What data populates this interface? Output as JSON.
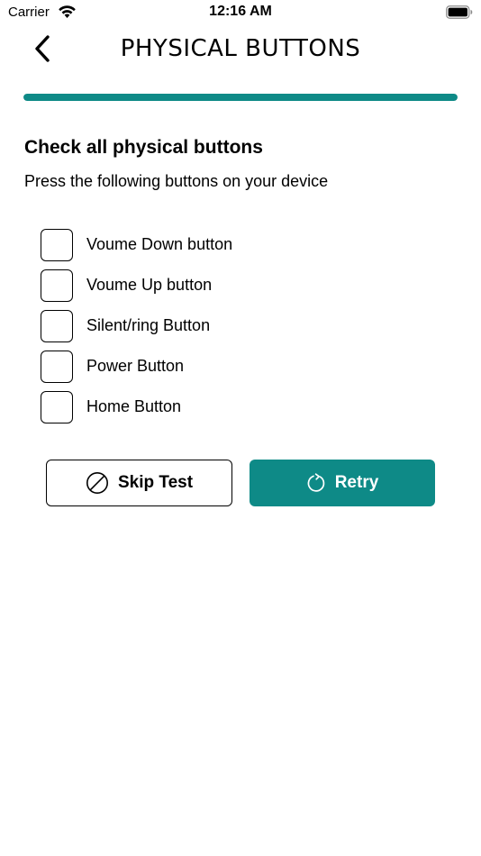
{
  "status_bar": {
    "carrier": "Carrier",
    "time": "12:16 AM",
    "wifi_icon": "wifi-icon",
    "battery_icon": "battery-icon"
  },
  "nav": {
    "back_icon": "chevron-left-icon",
    "title": "PHYSICAL BUTTONS"
  },
  "progress": {
    "value": 1.0,
    "color": "#0e8a87"
  },
  "content": {
    "title": "Check all physical buttons",
    "subtitle": "Press the following buttons on your device",
    "items": [
      {
        "label": "Voume Down button",
        "checked": false
      },
      {
        "label": "Voume Up button",
        "checked": false
      },
      {
        "label": "Silent/ring Button",
        "checked": false
      },
      {
        "label": "Power Button",
        "checked": false
      },
      {
        "label": "Home Button",
        "checked": false
      }
    ]
  },
  "actions": {
    "skip_label": "Skip Test",
    "skip_icon": "prohibited-icon",
    "retry_label": "Retry",
    "retry_icon": "refresh-icon"
  },
  "colors": {
    "accent": "#0e8a87"
  }
}
